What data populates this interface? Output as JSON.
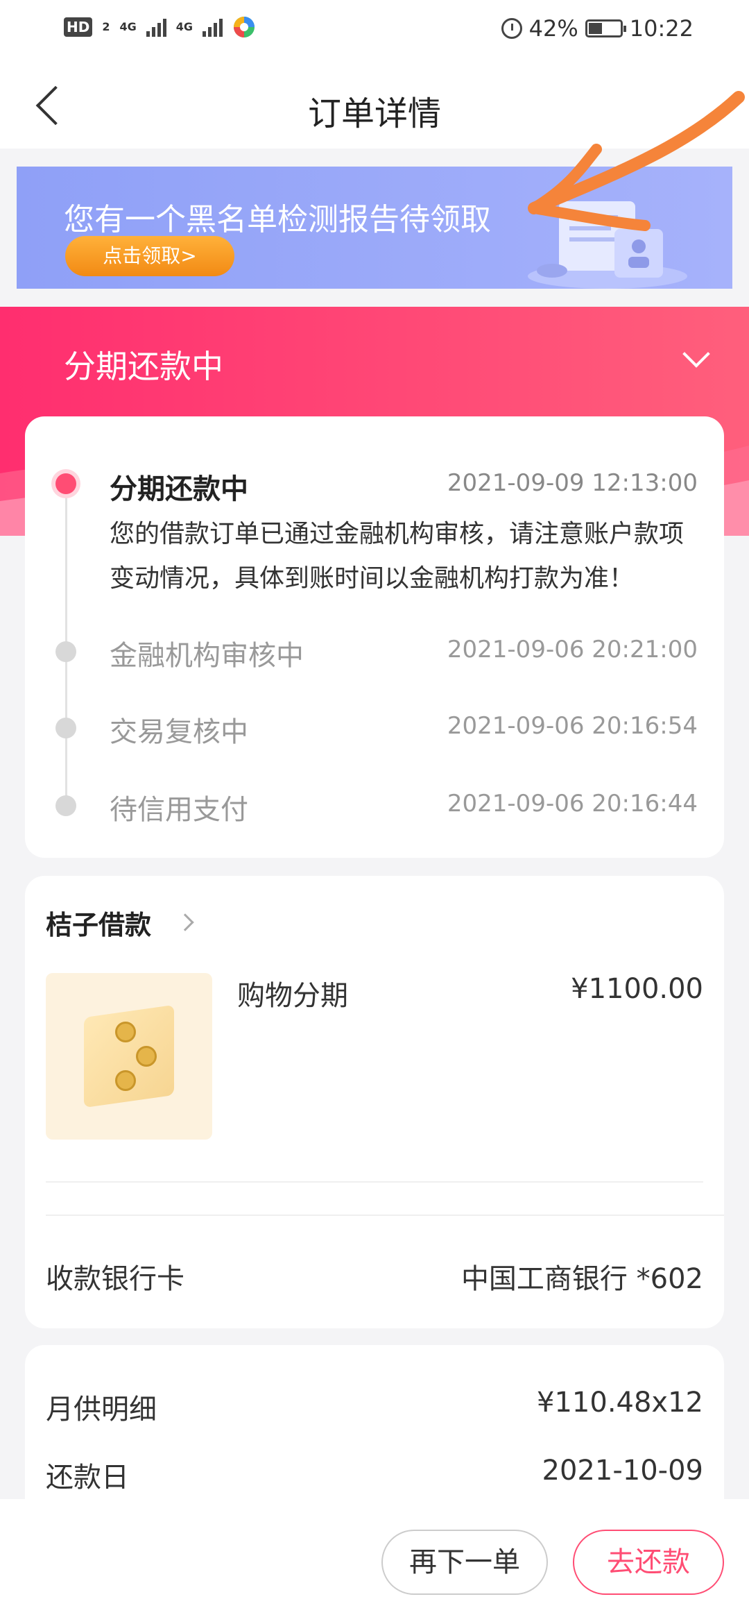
{
  "status_bar": {
    "hd_label": "HD",
    "sim1_label": "2",
    "net1": "4G",
    "net2": "4G",
    "battery_pct": "42%",
    "time": "10:22"
  },
  "header": {
    "title": "订单详情"
  },
  "banner": {
    "text": "您有一个黑名单检测报告待领取",
    "button": "点击领取>"
  },
  "hero": {
    "title": "分期还款中"
  },
  "timeline": {
    "current": {
      "name": "分期还款中",
      "time": "2021-09-09 12:13:00",
      "desc": "您的借款订单已通过金融机构审核，请注意账户款项变动情况，具体到账时间以金融机构打款为准！"
    },
    "steps": [
      {
        "name": "金融机构审核中",
        "time": "2021-09-06 20:21:00"
      },
      {
        "name": "交易复核中",
        "time": "2021-09-06 20:16:54"
      },
      {
        "name": "待信用支付",
        "time": "2021-09-06 20:16:44"
      }
    ]
  },
  "product": {
    "lender": "桔子借款",
    "name": "购物分期",
    "price": "¥1100.00",
    "bank_label": "收款银行卡",
    "bank_value": "中国工商银行 *602"
  },
  "detail": {
    "monthly_label": "月供明细",
    "monthly_value": "¥110.48x12",
    "due_label": "还款日",
    "due_value": "2021-10-09"
  },
  "actions": {
    "again": "再下一单",
    "repay": "去还款"
  },
  "colors": {
    "accent": "#ff3d6f",
    "banner": "#97a5f8",
    "banner_button": "#f59a1e",
    "annotation": "#f5843a"
  }
}
